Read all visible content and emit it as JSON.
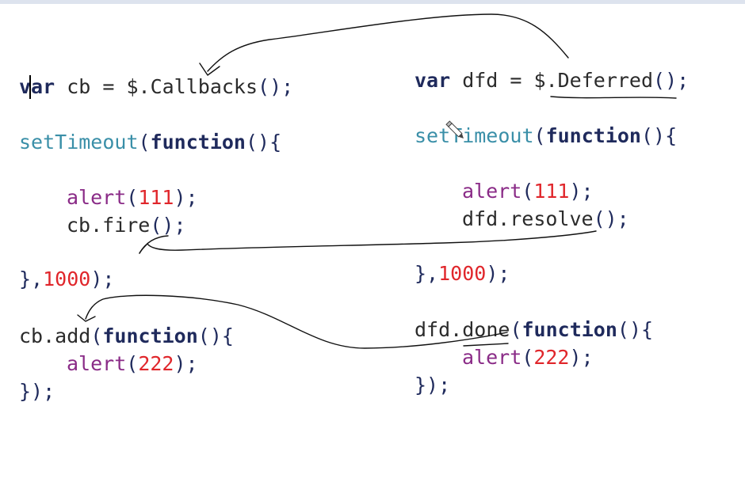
{
  "left": {
    "var_kw": "var",
    "var_rest": " cb = $.",
    "callbacks_name": "Callbacks",
    "callbacks_parens": "();",
    "timeout_name": "setTimeout",
    "timeout_open": "(",
    "function_kw": "function",
    "function_parens": "(){",
    "alert_name": "alert",
    "alert_open": "(",
    "alert_num": "111",
    "alert_close": ");",
    "fire_obj": "cb.",
    "fire_name": "fire",
    "fire_parens": "();",
    "close_brace": "},",
    "delay": "1000",
    "close_paren": ");",
    "add_obj": "cb.",
    "add_name": "add",
    "add_open": "(",
    "add_function_kw": "function",
    "add_function_parens": "(){",
    "alert2_name": "alert",
    "alert2_open": "(",
    "alert2_num": "222",
    "alert2_close": ");",
    "end": "});"
  },
  "right": {
    "var_kw": "var",
    "var_rest": " dfd = $.",
    "deferred_name": "Deferred",
    "deferred_parens": "();",
    "timeout_name": "setTimeout",
    "timeout_open": "(",
    "function_kw": "function",
    "function_parens": "(){",
    "alert_name": "alert",
    "alert_open": "(",
    "alert_num": "111",
    "alert_close": ");",
    "resolve_obj": "dfd.",
    "resolve_name": "resolve",
    "resolve_parens": "();",
    "close_brace": "},",
    "delay": "1000",
    "close_paren": ");",
    "done_obj": "dfd.",
    "done_name": "done",
    "done_open": "(",
    "done_function_kw": "function",
    "done_function_parens": "(){",
    "alert2_name": "alert",
    "alert2_open": "(",
    "alert2_num": "222",
    "alert2_close": ");",
    "end": "});"
  },
  "colors": {
    "keyword": "#1f2a5c",
    "function_name": "#3a8fa8",
    "alert": "#8a2b87",
    "number": "#e0262b",
    "annotation_ink": "#111111"
  }
}
